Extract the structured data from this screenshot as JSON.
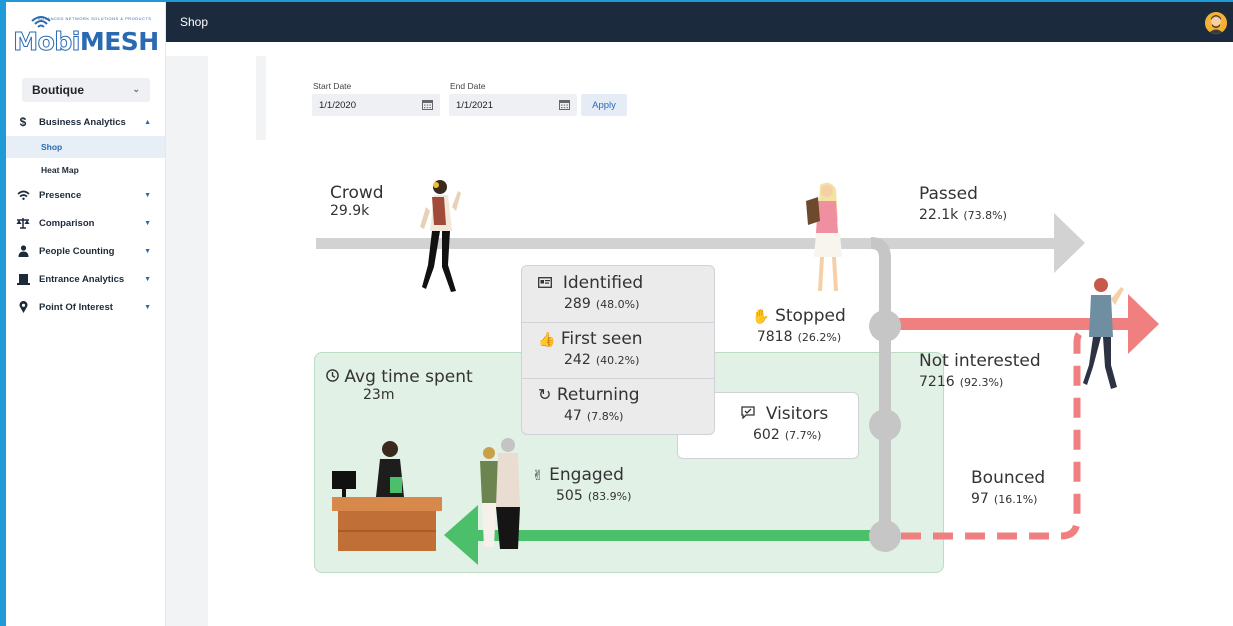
{
  "app": {
    "brand": "MobiMESH",
    "brand_prefix": "Mobi",
    "brand_suffix": "MESH",
    "tagline": "ADVANCED NETWORK SOLUTIONS & PRODUCTS",
    "accent": "#2a6ab3",
    "topbar_color": "#1c2a3d"
  },
  "sidebar": {
    "site_select": {
      "value": "Boutique",
      "icon": "chevron-down-icon"
    },
    "items": [
      {
        "label": "Business Analytics",
        "icon": "dollar-icon",
        "expanded": true,
        "children": [
          {
            "label": "Shop",
            "active": true
          },
          {
            "label": "Heat Map",
            "active": false
          }
        ]
      },
      {
        "label": "Presence",
        "icon": "wifi-icon"
      },
      {
        "label": "Comparison",
        "icon": "scale-icon"
      },
      {
        "label": "People Counting",
        "icon": "person-icon"
      },
      {
        "label": "Entrance Analytics",
        "icon": "entrance-icon"
      },
      {
        "label": "Point Of Interest",
        "icon": "map-pin-icon"
      }
    ]
  },
  "topbar": {
    "title": "Shop",
    "avatar_icon": "user-avatar-icon"
  },
  "filters": {
    "start_label": "Start Date",
    "start_value": "1/1/2020",
    "end_label": "End Date",
    "end_value": "1/1/2021",
    "apply_label": "Apply"
  },
  "funnel": {
    "crowd": {
      "label": "Crowd",
      "value": "29.9k"
    },
    "passed": {
      "label": "Passed",
      "value": "22.1k",
      "pct": "(73.8%)"
    },
    "stopped": {
      "label": "Stopped",
      "value": "7818",
      "pct": "(26.2%)",
      "icon": "hand-icon"
    },
    "not_interested": {
      "label": "Not interested",
      "value": "7216",
      "pct": "(92.3%)"
    },
    "identified": {
      "label": "Identified",
      "value": "289",
      "pct": "(48.0%)",
      "icon": "id-card-icon"
    },
    "first_seen": {
      "label": "First seen",
      "value": "242",
      "pct": "(40.2%)",
      "icon": "thumb-icon"
    },
    "returning": {
      "label": "Returning",
      "value": "47",
      "pct": "(7.8%)",
      "icon": "refresh-icon"
    },
    "visitors": {
      "label": "Visitors",
      "value": "602",
      "pct": "(7.7%)",
      "icon": "chat-check-icon"
    },
    "avg_time": {
      "label": "Avg time spent",
      "value": "23m",
      "icon": "clock-icon"
    },
    "engaged": {
      "label": "Engaged",
      "value": "505",
      "pct": "(83.9%)",
      "icon": "handshake-icon"
    },
    "bounced": {
      "label": "Bounced",
      "value": "97",
      "pct": "(16.1%)"
    },
    "colors": {
      "passed_arrow": "#d2d2d2",
      "not_interested_arrow": "#f08080",
      "engaged_arrow": "#4cbf6a",
      "engaged_box": "#e2f1e6"
    }
  }
}
